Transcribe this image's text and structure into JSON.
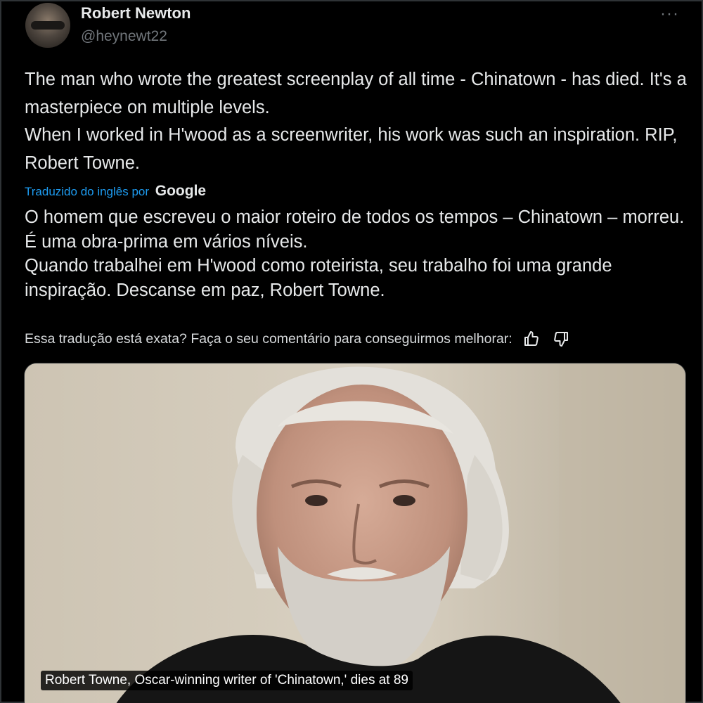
{
  "author": {
    "display_name": "Robert Newton",
    "handle": "@heynewt22"
  },
  "tweet": {
    "lines": [
      "The man who wrote the greatest screenplay of all time - Chinatown - has died.  It's a masterpiece on multiple levels.",
      "When I worked in H'wood as a screenwriter, his work was such an inspiration.  RIP, Robert Towne."
    ]
  },
  "translation": {
    "label": "Traduzido do inglês por",
    "provider": "Google",
    "lines": [
      "O homem que escreveu o maior roteiro de todos os tempos – Chinatown – morreu. É uma obra-prima em vários níveis.",
      "Quando trabalhei em H'wood como roteirista, seu trabalho foi uma grande inspiração. Descanse em paz, Robert Towne."
    ],
    "feedback_prompt": "Essa tradução está exata? Faça o seu comentário para conseguirmos melhorar:"
  },
  "media": {
    "caption": "Robert Towne, Oscar-winning writer of 'Chinatown,' dies at 89"
  },
  "icons": {
    "more": "more-options-icon",
    "thumbs_up": "thumbs-up-icon",
    "thumbs_down": "thumbs-down-icon"
  },
  "colors": {
    "background": "#000000",
    "text": "#e7e9ea",
    "secondary": "#71767b",
    "link": "#1d9bf0"
  }
}
